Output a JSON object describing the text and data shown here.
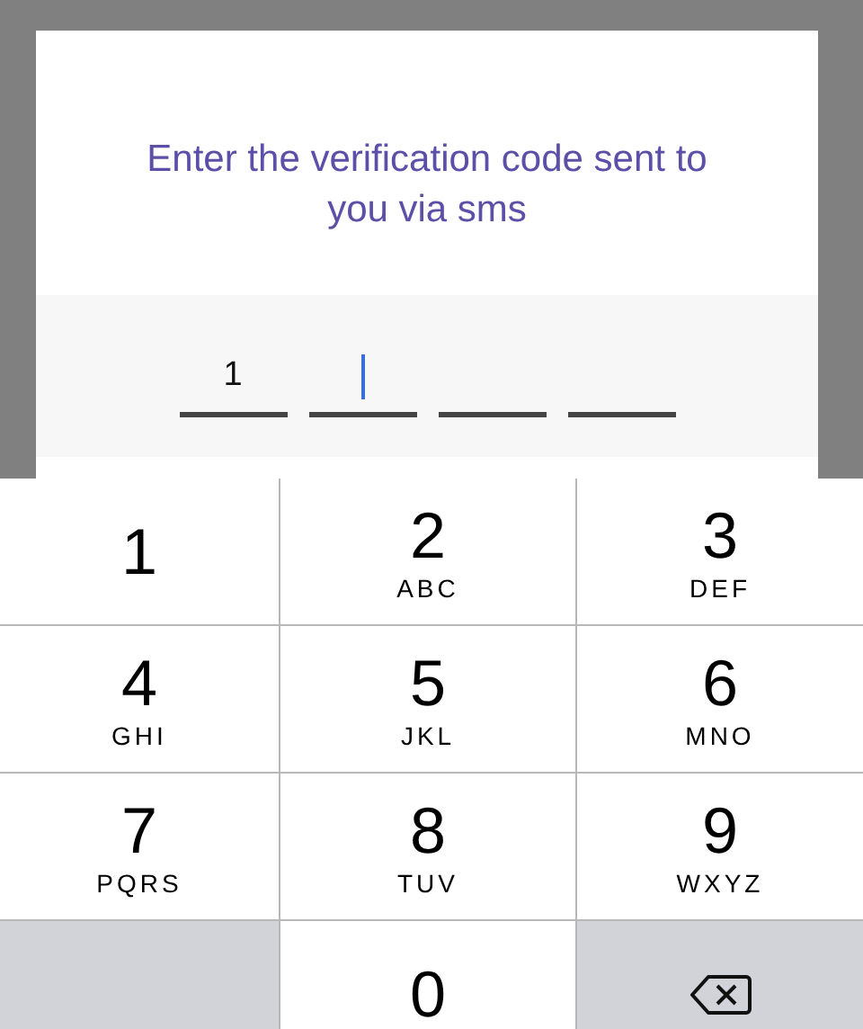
{
  "dialog": {
    "title": "Enter the verification code sent to you via sms",
    "code_cells": [
      {
        "value": "1",
        "focused": false
      },
      {
        "focused": true
      },
      {
        "focused": false
      },
      {
        "focused": false
      }
    ]
  },
  "keypad": [
    {
      "kind": "digit",
      "digit": "1"
    },
    {
      "kind": "digit",
      "digit": "2",
      "letters": "ABC"
    },
    {
      "kind": "digit",
      "digit": "3",
      "letters": "DEF"
    },
    {
      "kind": "digit",
      "digit": "4",
      "letters": "GHI"
    },
    {
      "kind": "digit",
      "digit": "5",
      "letters": "JKL"
    },
    {
      "kind": "digit",
      "digit": "6",
      "letters": "MNO"
    },
    {
      "kind": "digit",
      "digit": "7",
      "letters": "PQRS"
    },
    {
      "kind": "digit",
      "digit": "8",
      "letters": "TUV"
    },
    {
      "kind": "digit",
      "digit": "9",
      "letters": "WXYZ"
    },
    {
      "kind": "blank"
    },
    {
      "kind": "digit",
      "digit": "0"
    },
    {
      "kind": "delete"
    }
  ]
}
